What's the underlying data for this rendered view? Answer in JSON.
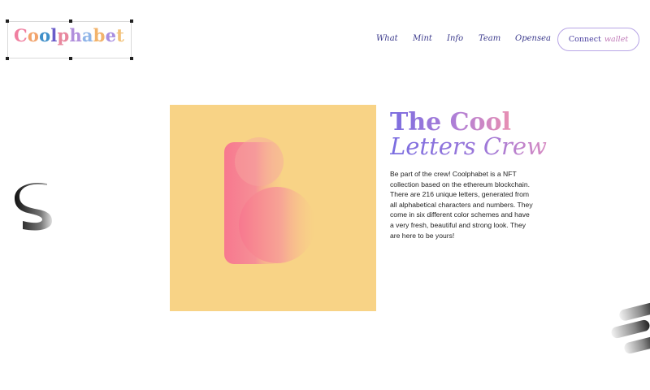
{
  "logo": {
    "letters": [
      {
        "ch": "C",
        "color": "#f07fa0"
      },
      {
        "ch": "o",
        "color": "#f2a36b"
      },
      {
        "ch": "o",
        "color": "#3f8fc9"
      },
      {
        "ch": "l",
        "color": "#6a5cc9"
      },
      {
        "ch": "p",
        "color": "#e8879e"
      },
      {
        "ch": "h",
        "color": "#b18fdc"
      },
      {
        "ch": "a",
        "color": "#8fb5e8"
      },
      {
        "ch": "b",
        "color": "#f2b36b"
      },
      {
        "ch": "e",
        "color": "#a88ee0"
      },
      {
        "ch": "t",
        "color": "#f2c27a"
      }
    ]
  },
  "nav": {
    "items": [
      "What",
      "Mint",
      "Info",
      "Team",
      "Opensea"
    ]
  },
  "connect": {
    "label_1": "Connect",
    "label_2": "wallet"
  },
  "hero": {
    "title_line1": "The Cool",
    "title_line2": "Letters Crew",
    "description": "Be part of the crew! Coolphabet is a NFT collection based on the ethereum blockchain. There are 216 unique letters, generated from all alphabetical characters and numbers. They come in six different color schemes and have a very fresh, beautiful and strong look. They are here to be yours!"
  },
  "colors": {
    "hero_bg": "#f8d386",
    "letter_pink": "#f87c92",
    "nav_text": "#3b3a8c",
    "button_border": "#b8a6e6"
  },
  "icons": [
    "letter-s-decoration",
    "letter-e-decoration",
    "letter-b-artwork"
  ]
}
